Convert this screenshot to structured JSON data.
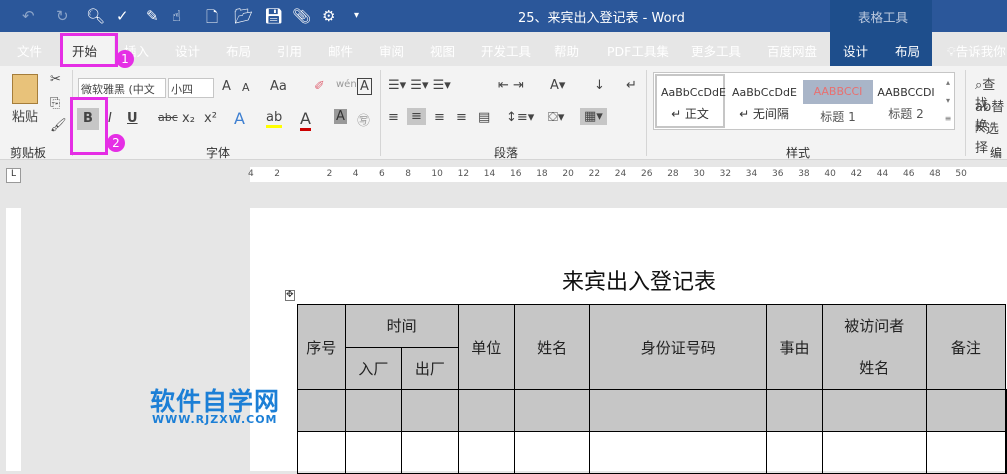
{
  "title": "25、来宾出入登记表  -  Word",
  "context_tab_group": "表格工具",
  "tabs": [
    "文件",
    "开始",
    "插入",
    "设计",
    "布局",
    "引用",
    "邮件",
    "审阅",
    "视图",
    "开发工具",
    "帮助",
    "PDF工具集",
    "更多工具",
    "百度网盘",
    "设计",
    "布局"
  ],
  "tell_me": "告诉我你",
  "clipboard": {
    "paste": "粘贴",
    "label": "剪贴板"
  },
  "font": {
    "name": "微软雅黑 (中文",
    "size": "小四",
    "label": "字体",
    "bold": "B",
    "italic": "I",
    "underline": "U",
    "strike": "abc",
    "sub": "x₂",
    "sup": "x²",
    "grow": "A",
    "case": "Aa"
  },
  "paragraph": {
    "label": "段落"
  },
  "styles": {
    "label": "样式",
    "items": [
      {
        "preview": "AaBbCcDdE",
        "name": "↵ 正文"
      },
      {
        "preview": "AaBbCcDdE",
        "name": "↵ 无间隔"
      },
      {
        "preview": "AABBCCI",
        "name": "标题 1"
      },
      {
        "preview": "AABBCCDI",
        "name": "标题 2"
      }
    ]
  },
  "editing": {
    "find": "查找",
    "replace": "替换",
    "select": "选择",
    "label": "编辑"
  },
  "annotations": [
    "1",
    "2"
  ],
  "ruler_ticks": [
    "4",
    "2",
    "",
    "2",
    "4",
    "6",
    "8",
    "10",
    "12",
    "14",
    "16",
    "18",
    "20",
    "22",
    "24",
    "26",
    "28",
    "30",
    "32",
    "34",
    "36",
    "38",
    "40",
    "42",
    "44",
    "46",
    "48",
    "50"
  ],
  "doc": {
    "title": "来宾出入登记表",
    "headers": {
      "no": "序号",
      "time": "时间",
      "in": "入厂",
      "out": "出厂",
      "unit": "单位",
      "name": "姓名",
      "id": "身份证号码",
      "reason": "事由",
      "visitee": "被访问者",
      "visitee2": "姓名",
      "note": "备注"
    }
  },
  "watermark": {
    "cn": "软件自学网",
    "url": "WWW.RJZXW.COM"
  }
}
